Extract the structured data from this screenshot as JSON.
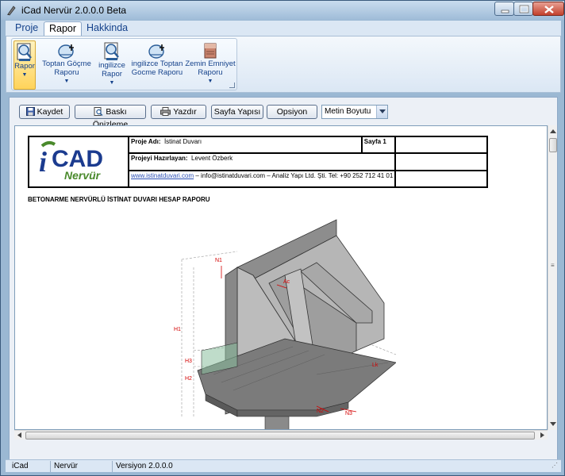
{
  "window": {
    "title": "iCad Nervür 2.0.0.0 Beta"
  },
  "tabs": [
    {
      "label": "Proje"
    },
    {
      "label": "Rapor"
    },
    {
      "label": "Hakkinda"
    }
  ],
  "ribbon": {
    "buttons": [
      {
        "line1": "Rapor",
        "line2": "",
        "icon": "report-magnifier-icon"
      },
      {
        "line1": "Toptan Göçme",
        "line2": "Raporu",
        "icon": "bulk-collapse-report-icon"
      },
      {
        "line1": "ingilizce",
        "line2": "Rapor",
        "icon": "english-report-icon"
      },
      {
        "line1": "ingilizce Toptan",
        "line2": "Gocme Raporu",
        "icon": "english-bulk-collapse-report-icon"
      },
      {
        "line1": "Zemin Emniyet",
        "line2": "Raporu",
        "icon": "soil-safety-report-icon"
      }
    ],
    "dropdown_glyph": "▼"
  },
  "toolbar": {
    "save_label": "Kaydet",
    "preview_label": "Baskı Önizleme",
    "print_label": "Yazdır",
    "page_setup_label": "Sayfa Yapısı",
    "options_label": "Opsiyon",
    "text_size_value": "Metin Boyutu"
  },
  "document": {
    "project_name_label": "Proje Adı:",
    "project_name_value": "İstinat Duvarı",
    "page_label": "Sayfa 1",
    "prepared_by_label": "Projeyi Hazırlayan:",
    "prepared_by_value": "Levent Özberk",
    "website_link": "www.istinatduvari.com",
    "contact_text": " – info@istinatduvari.com – Analiz Yapı Ltd. Şti. Tel: +90 252 712 41 01",
    "logo_main": "CAD",
    "logo_i": "i",
    "logo_sub": "Nervür",
    "report_title": "BETONARME NERVÜRLÜ İSTİNAT DUVARI HESAP RAPORU",
    "drawing_labels": {
      "n1": "N1",
      "n2": "N2",
      "n3": "N3",
      "h1": "H1",
      "h2": "H2",
      "h3": "H3",
      "lk": "Lk",
      "ac": "Ac"
    }
  },
  "status": {
    "items": [
      "iCad",
      "Nervür",
      "Versiyon 2.0.0.0"
    ]
  },
  "colors": {
    "accent": "#15428b",
    "logo_blue": "#1b3b8f",
    "logo_green": "#4a8a2c",
    "dimension_red": "#d40000"
  }
}
